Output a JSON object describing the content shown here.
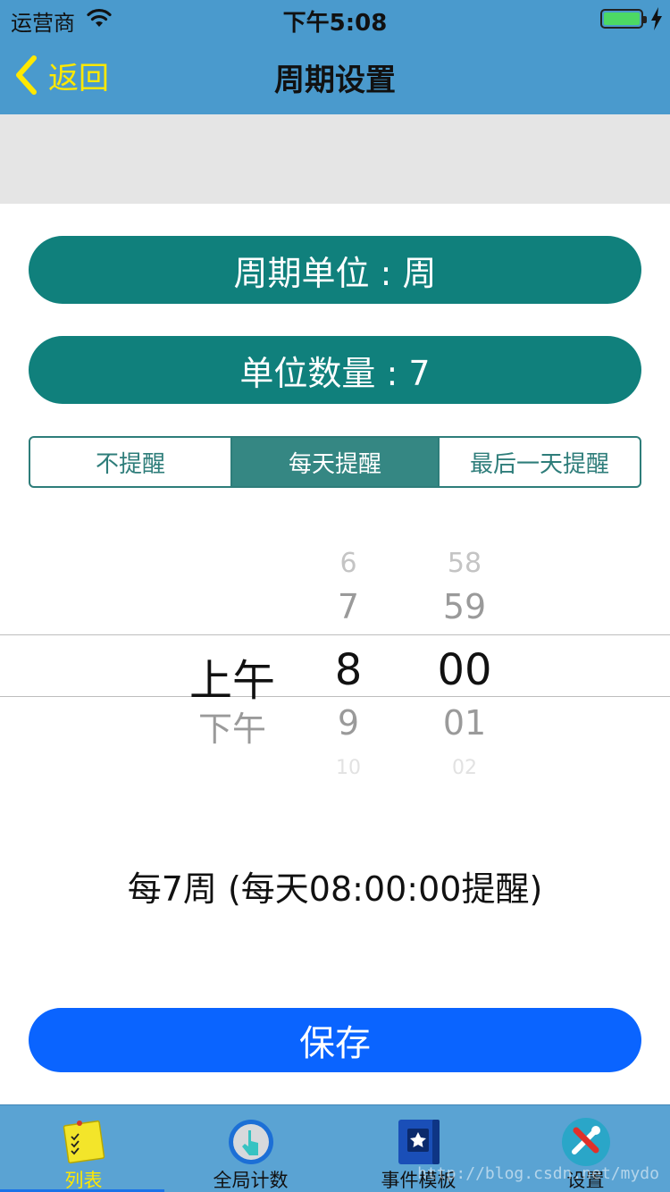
{
  "status_bar": {
    "carrier": "运营商",
    "time": "下午5:08"
  },
  "nav": {
    "back_label": "返回",
    "title": "周期设置"
  },
  "period": {
    "unit_label": "周期单位 : 周",
    "count_label": "单位数量 : 7"
  },
  "reminder": {
    "options": [
      "不提醒",
      "每天提醒",
      "最后一天提醒"
    ],
    "selected_index": 1
  },
  "picker": {
    "ampm": [
      "上午",
      "下午"
    ],
    "hours": [
      "6",
      "7",
      "8",
      "9",
      "10"
    ],
    "minutes": [
      "58",
      "59",
      "00",
      "01",
      "02"
    ],
    "selected": {
      "ampm": "上午",
      "hour": "8",
      "minute": "00"
    }
  },
  "summary": "每7周 (每天08:00:00提醒)",
  "save_label": "保存",
  "tabbar": {
    "items": [
      {
        "label": "列表",
        "icon": "notepad-icon"
      },
      {
        "label": "全局计数",
        "icon": "tap-counter-icon"
      },
      {
        "label": "事件模板",
        "icon": "template-book-icon"
      },
      {
        "label": "设置",
        "icon": "tools-icon"
      }
    ],
    "selected_index": 0
  },
  "watermark": "http://blog.csdn.net/mydo",
  "colors": {
    "nav_bar": "#4a9acd",
    "accent_yellow": "#ffe800",
    "pill_teal": "#10807c",
    "segment_teal": "#358783",
    "save_blue": "#0a64ff",
    "tab_bar": "#5aa3d3"
  }
}
